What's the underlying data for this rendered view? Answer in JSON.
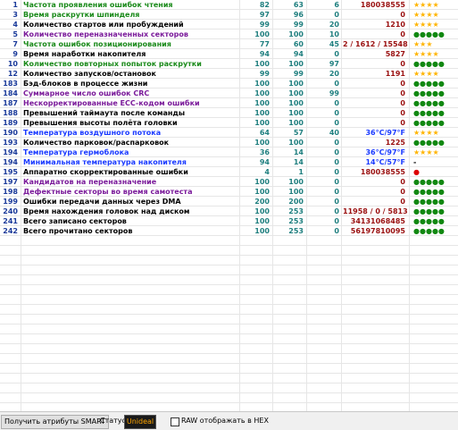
{
  "colors": {
    "green": "#1a8a1a",
    "purple": "#7a1a9a",
    "blue": "#1a3aff",
    "black": "#000000",
    "raw_red": "#9a1010",
    "raw_blue": "#1a3aff",
    "star_gold": "#ffb400",
    "dot_green": "#118811",
    "dot_red": "#dd0000",
    "status_bg": "#1a1a1a",
    "status_fg": "#ffa500"
  },
  "attributes": [
    {
      "id": "1",
      "name": "Частота проявления ошибок чтения",
      "cur": "82",
      "worst": "63",
      "thr": "6",
      "raw": "180038555",
      "rating": "★★★★",
      "name_color": "green",
      "raw_color": "raw_red",
      "rating_color": "star_gold"
    },
    {
      "id": "3",
      "name": "Время раскрутки шпинделя",
      "cur": "97",
      "worst": "96",
      "thr": "0",
      "raw": "0",
      "rating": "★★★★",
      "name_color": "green",
      "raw_color": "raw_red",
      "rating_color": "star_gold"
    },
    {
      "id": "4",
      "name": "Количество стартов или пробуждений",
      "cur": "99",
      "worst": "99",
      "thr": "20",
      "raw": "1210",
      "rating": "★★★★",
      "name_color": "black",
      "raw_color": "raw_red",
      "rating_color": "star_gold"
    },
    {
      "id": "5",
      "name": "Количество переназначенных секторов",
      "cur": "100",
      "worst": "100",
      "thr": "10",
      "raw": "0",
      "rating": "●●●●●",
      "name_color": "purple",
      "raw_color": "raw_red",
      "rating_color": "dot_green"
    },
    {
      "id": "7",
      "name": "Частота ошибок позиционирования",
      "cur": "77",
      "worst": "60",
      "thr": "45",
      "raw": "2 / 1612 / 15548",
      "rating": "★★★",
      "name_color": "green",
      "raw_color": "raw_red",
      "rating_color": "star_gold"
    },
    {
      "id": "9",
      "name": "Время наработки накопителя",
      "cur": "94",
      "worst": "94",
      "thr": "0",
      "raw": "5827",
      "rating": "★★★★",
      "name_color": "black",
      "raw_color": "raw_red",
      "rating_color": "star_gold"
    },
    {
      "id": "10",
      "name": "Количество повторных попыток раскрутки",
      "cur": "100",
      "worst": "100",
      "thr": "97",
      "raw": "0",
      "rating": "●●●●●",
      "name_color": "green",
      "raw_color": "raw_red",
      "rating_color": "dot_green"
    },
    {
      "id": "12",
      "name": "Количество запусков/остановок",
      "cur": "99",
      "worst": "99",
      "thr": "20",
      "raw": "1191",
      "rating": "★★★★",
      "name_color": "black",
      "raw_color": "raw_red",
      "rating_color": "star_gold"
    },
    {
      "id": "183",
      "name": "Бэд-блоков в процессе жизни",
      "cur": "100",
      "worst": "100",
      "thr": "0",
      "raw": "0",
      "rating": "●●●●●",
      "name_color": "black",
      "raw_color": "raw_red",
      "rating_color": "dot_green"
    },
    {
      "id": "184",
      "name": "Суммарное число ошибок CRC",
      "cur": "100",
      "worst": "100",
      "thr": "99",
      "raw": "0",
      "rating": "●●●●●",
      "name_color": "purple",
      "raw_color": "raw_red",
      "rating_color": "dot_green"
    },
    {
      "id": "187",
      "name": "Нескорректированные ECC-кодом ошибки",
      "cur": "100",
      "worst": "100",
      "thr": "0",
      "raw": "0",
      "rating": "●●●●●",
      "name_color": "purple",
      "raw_color": "raw_red",
      "rating_color": "dot_green"
    },
    {
      "id": "188",
      "name": "Превышений таймаута после команды",
      "cur": "100",
      "worst": "100",
      "thr": "0",
      "raw": "0",
      "rating": "●●●●●",
      "name_color": "black",
      "raw_color": "raw_red",
      "rating_color": "dot_green"
    },
    {
      "id": "189",
      "name": "Превышения высоты полёта головки",
      "cur": "100",
      "worst": "100",
      "thr": "0",
      "raw": "0",
      "rating": "●●●●●",
      "name_color": "black",
      "raw_color": "raw_red",
      "rating_color": "dot_green"
    },
    {
      "id": "190",
      "name": "Температура воздушного потока",
      "cur": "64",
      "worst": "57",
      "thr": "40",
      "raw": "36°C/97°F",
      "rating": "★★★★",
      "name_color": "blue",
      "raw_color": "raw_blue",
      "rating_color": "star_gold"
    },
    {
      "id": "193",
      "name": "Количество парковок/распарковок",
      "cur": "100",
      "worst": "100",
      "thr": "0",
      "raw": "1225",
      "rating": "●●●●●",
      "name_color": "black",
      "raw_color": "raw_red",
      "rating_color": "dot_green"
    },
    {
      "id": "194",
      "name": "Температура гермоблока",
      "cur": "36",
      "worst": "14",
      "thr": "0",
      "raw": "36°C/97°F",
      "rating": "★★★★",
      "name_color": "blue",
      "raw_color": "raw_blue",
      "rating_color": "star_gold"
    },
    {
      "id": "194",
      "name": "Минимальная температура накопителя",
      "cur": "94",
      "worst": "14",
      "thr": "0",
      "raw": "14°C/57°F",
      "rating": "-",
      "name_color": "blue",
      "raw_color": "raw_blue",
      "rating_color": "black"
    },
    {
      "id": "195",
      "name": "Аппаратно скорректированные ошибки",
      "cur": "4",
      "worst": "1",
      "thr": "0",
      "raw": "180038555",
      "rating": "●",
      "name_color": "black",
      "raw_color": "raw_red",
      "rating_color": "dot_red"
    },
    {
      "id": "197",
      "name": "Кандидатов на переназначение",
      "cur": "100",
      "worst": "100",
      "thr": "0",
      "raw": "0",
      "rating": "●●●●●",
      "name_color": "purple",
      "raw_color": "raw_red",
      "rating_color": "dot_green"
    },
    {
      "id": "198",
      "name": "Дефектные секторы во время самотеста",
      "cur": "100",
      "worst": "100",
      "thr": "0",
      "raw": "0",
      "rating": "●●●●●",
      "name_color": "purple",
      "raw_color": "raw_red",
      "rating_color": "dot_green"
    },
    {
      "id": "199",
      "name": "Ошибки передачи данных через DMA",
      "cur": "200",
      "worst": "200",
      "thr": "0",
      "raw": "0",
      "rating": "●●●●●",
      "name_color": "black",
      "raw_color": "raw_red",
      "rating_color": "dot_green"
    },
    {
      "id": "240",
      "name": "Время нахождения головок над диском",
      "cur": "100",
      "worst": "253",
      "thr": "0",
      "raw": "11958 / 0 / 5813",
      "rating": "●●●●●",
      "name_color": "black",
      "raw_color": "raw_red",
      "rating_color": "dot_green"
    },
    {
      "id": "241",
      "name": "Всего записано секторов",
      "cur": "100",
      "worst": "253",
      "thr": "0",
      "raw": "34131068485",
      "rating": "●●●●●",
      "name_color": "black",
      "raw_color": "raw_red",
      "rating_color": "dot_green"
    },
    {
      "id": "242",
      "name": "Всего прочитано секторов",
      "cur": "100",
      "worst": "253",
      "thr": "0",
      "raw": "56197810095",
      "rating": "●●●●●",
      "name_color": "black",
      "raw_color": "raw_red",
      "rating_color": "dot_green"
    }
  ],
  "bottom_bar": {
    "get_button": "Получить атрибуты SMART",
    "status_label": "Статус:",
    "status_value": "Unideal",
    "raw_checkbox_label": "RAW отображать в HEX"
  }
}
